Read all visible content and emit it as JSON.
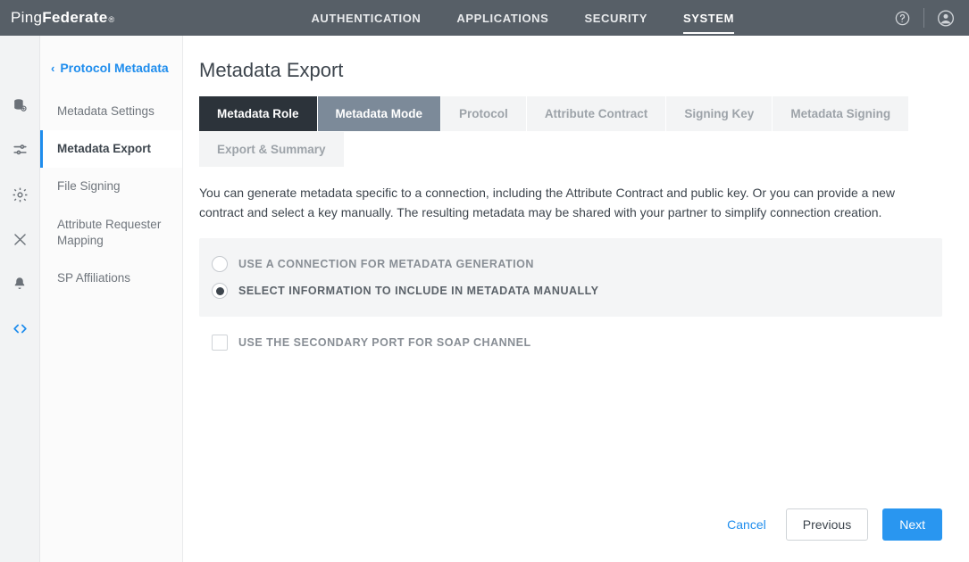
{
  "brand": {
    "prefix": "Ping",
    "suffix": "Federate"
  },
  "topnav": [
    "AUTHENTICATION",
    "APPLICATIONS",
    "SECURITY",
    "SYSTEM"
  ],
  "topnav_active": 3,
  "sidebar": {
    "back_label": "Protocol Metadata",
    "items": [
      "Metadata Settings",
      "Metadata Export",
      "File Signing",
      "Attribute Requester Mapping",
      "SP Affiliations"
    ],
    "active": 1
  },
  "page": {
    "title": "Metadata Export",
    "wizard_tabs": [
      "Metadata Role",
      "Metadata Mode",
      "Protocol",
      "Attribute Contract",
      "Signing Key",
      "Metadata Signing",
      "Export & Summary"
    ],
    "wizard_current": 1,
    "description": "You can generate metadata specific to a connection, including the Attribute Contract and public key. Or you can provide a new contract and select a key manually. The resulting metadata may be shared with your partner to simplify connection creation.",
    "radio_options": [
      "USE A CONNECTION FOR METADATA GENERATION",
      "SELECT INFORMATION TO INCLUDE IN METADATA MANUALLY"
    ],
    "radio_selected": 1,
    "checkbox_label": "USE THE SECONDARY PORT FOR SOAP CHANNEL",
    "checkbox_checked": false
  },
  "footer": {
    "cancel": "Cancel",
    "previous": "Previous",
    "next": "Next"
  }
}
